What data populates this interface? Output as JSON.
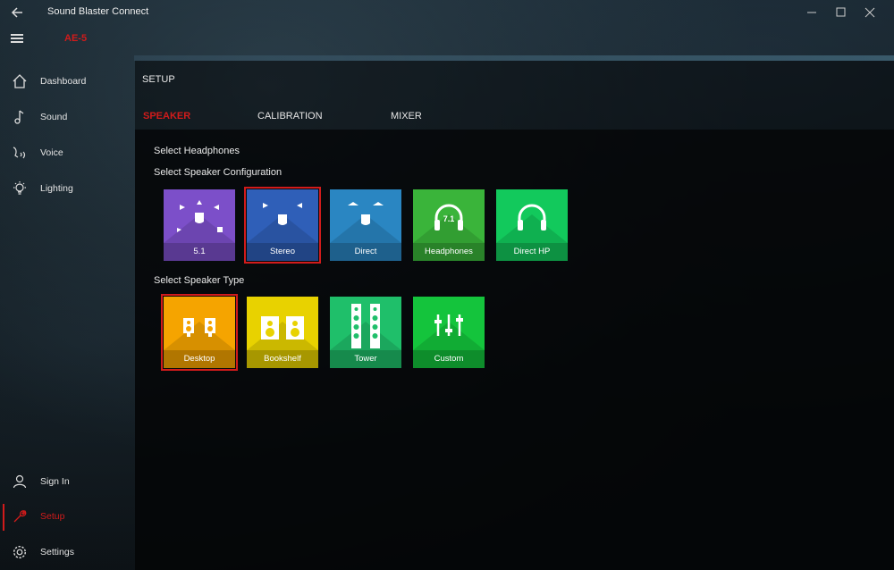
{
  "app": {
    "title": "Sound Blaster Connect",
    "device": "AE-5"
  },
  "window_controls": {
    "minimize": "—",
    "maximize": "☐",
    "close": "✕"
  },
  "sidebar": {
    "items": [
      {
        "label": "Dashboard",
        "icon": "home-icon"
      },
      {
        "label": "Sound",
        "icon": "music-note-icon"
      },
      {
        "label": "Voice",
        "icon": "voice-icon"
      },
      {
        "label": "Lighting",
        "icon": "bulb-icon"
      }
    ],
    "bottom_items": [
      {
        "label": "Sign In",
        "icon": "user-icon"
      },
      {
        "label": "Setup",
        "icon": "wrench-icon",
        "active": true
      },
      {
        "label": "Settings",
        "icon": "gear-icon"
      }
    ]
  },
  "main": {
    "title": "SETUP",
    "tabs": [
      {
        "label": "SPEAKER",
        "active": true
      },
      {
        "label": "CALIBRATION"
      },
      {
        "label": "MIXER"
      }
    ],
    "select_headphones": "Select Headphones",
    "config_heading": "Select Speaker Configuration",
    "configs": [
      {
        "label": "5.1",
        "color": "#7c4fc9"
      },
      {
        "label": "Stereo",
        "color": "#2f5fb8",
        "selected": true
      },
      {
        "label": "Direct",
        "color": "#2a86c2"
      },
      {
        "label": "Headphones",
        "color": "#3ab43a"
      },
      {
        "label": "Direct HP",
        "color": "#12c95c"
      }
    ],
    "type_heading": "Select Speaker Type",
    "types": [
      {
        "label": "Desktop",
        "color": "#f5a400",
        "selected": true
      },
      {
        "label": "Bookshelf",
        "color": "#e8d200"
      },
      {
        "label": "Tower",
        "color": "#1fbf6a"
      },
      {
        "label": "Custom",
        "color": "#14c43c"
      }
    ]
  },
  "accent_color": "#d11b1b"
}
